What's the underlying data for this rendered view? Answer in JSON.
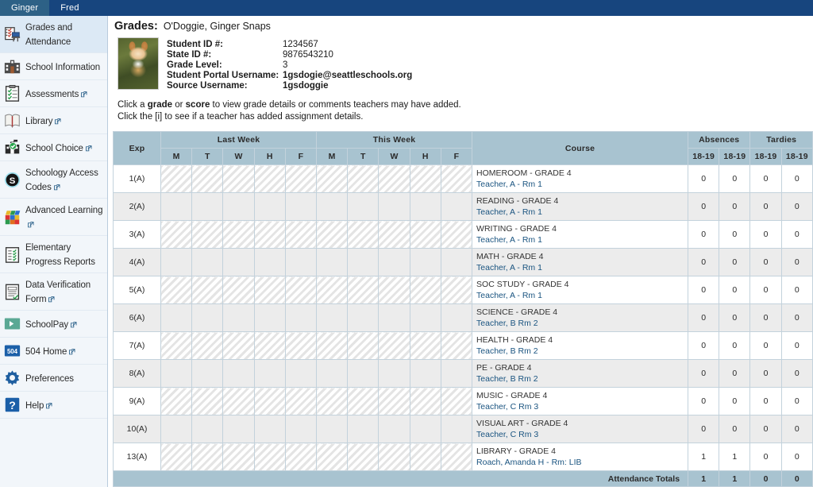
{
  "topbar": {
    "tabs": [
      {
        "label": "Ginger",
        "active": true
      },
      {
        "label": "Fred",
        "active": false
      }
    ]
  },
  "sidebar": {
    "items": [
      {
        "label": "Grades and Attendance",
        "icon": "grades-attendance-icon",
        "external": false,
        "selected": true
      },
      {
        "label": "School Information",
        "icon": "school-building-icon",
        "external": false,
        "selected": false
      },
      {
        "label": "Assessments",
        "icon": "clipboard-checklist-icon",
        "external": true,
        "selected": false
      },
      {
        "label": "Library",
        "icon": "open-book-icon",
        "external": true,
        "selected": false
      },
      {
        "label": "School Choice",
        "icon": "school-choice-icon",
        "external": true,
        "selected": false
      },
      {
        "label": "Schoology Access Codes",
        "icon": "schoology-s-icon",
        "external": true,
        "selected": false
      },
      {
        "label": "Advanced Learning",
        "icon": "rubiks-cube-icon",
        "external": true,
        "selected": false
      },
      {
        "label": "Elementary Progress Reports",
        "icon": "progress-report-icon",
        "external": false,
        "selected": false
      },
      {
        "label": "Data Verification Form",
        "icon": "document-check-icon",
        "external": true,
        "selected": false
      },
      {
        "label": "SchoolPay",
        "icon": "schoolpay-arrow-icon",
        "external": true,
        "selected": false
      },
      {
        "label": "504 Home",
        "icon": "504-badge-icon",
        "external": true,
        "selected": false
      },
      {
        "label": "Preferences",
        "icon": "gear-icon",
        "external": false,
        "selected": false
      },
      {
        "label": "Help",
        "icon": "question-mark-icon",
        "external": true,
        "selected": false
      }
    ]
  },
  "page": {
    "title": "Grades:",
    "student_name": "O'Doggie, Ginger Snaps"
  },
  "student": {
    "photo_alt": "student-photo",
    "fields": [
      {
        "label": "Student ID #:",
        "value": "1234567",
        "bold": false
      },
      {
        "label": "State ID #:",
        "value": "9876543210",
        "bold": false
      },
      {
        "label": "Grade Level:",
        "value": "3",
        "bold": false
      },
      {
        "label": "Student Portal Username:",
        "value": "1gsdogie@seattleschools.org",
        "bold": true
      },
      {
        "label": "Source Username:",
        "value": "1gsdoggie",
        "bold": true
      }
    ]
  },
  "instructions": {
    "line1_a": "Click a ",
    "line1_b": "grade",
    "line1_c": " or ",
    "line1_d": "score",
    "line1_e": " to view grade details or comments teachers may have added.",
    "line2": "Click the [i] to see if a teacher has added assignment details."
  },
  "table": {
    "headers": {
      "exp": "Exp",
      "last_week": "Last Week",
      "this_week": "This Week",
      "course": "Course",
      "absences": "Absences",
      "tardies": "Tardies",
      "days": [
        "M",
        "T",
        "W",
        "H",
        "F"
      ],
      "year_cols": [
        "18-19",
        "18-19",
        "18-19",
        "18-19"
      ]
    },
    "rows": [
      {
        "exp": "1(A)",
        "course": "HOMEROOM - GRADE 4",
        "teacher": "Teacher, A - Rm 1",
        "nums": [
          "0",
          "0",
          "0",
          "0"
        ]
      },
      {
        "exp": "2(A)",
        "course": "READING - GRADE 4",
        "teacher": "Teacher, A - Rm 1",
        "nums": [
          "0",
          "0",
          "0",
          "0"
        ]
      },
      {
        "exp": "3(A)",
        "course": "WRITING - GRADE 4",
        "teacher": "Teacher, A - Rm 1",
        "nums": [
          "0",
          "0",
          "0",
          "0"
        ]
      },
      {
        "exp": "4(A)",
        "course": "MATH - GRADE 4",
        "teacher": "Teacher, A - Rm 1",
        "nums": [
          "0",
          "0",
          "0",
          "0"
        ]
      },
      {
        "exp": "5(A)",
        "course": "SOC STUDY - GRADE 4",
        "teacher": "Teacher, A - Rm 1",
        "nums": [
          "0",
          "0",
          "0",
          "0"
        ]
      },
      {
        "exp": "6(A)",
        "course": "SCIENCE - GRADE 4",
        "teacher": "Teacher, B Rm 2",
        "nums": [
          "0",
          "0",
          "0",
          "0"
        ]
      },
      {
        "exp": "7(A)",
        "course": "HEALTH - GRADE 4",
        "teacher": "Teacher, B Rm 2",
        "nums": [
          "0",
          "0",
          "0",
          "0"
        ]
      },
      {
        "exp": "8(A)",
        "course": "PE - GRADE 4",
        "teacher": "Teacher, B Rm 2",
        "nums": [
          "0",
          "0",
          "0",
          "0"
        ]
      },
      {
        "exp": "9(A)",
        "course": "MUSIC - GRADE 4",
        "teacher": "Teacher, C Rm 3",
        "nums": [
          "0",
          "0",
          "0",
          "0"
        ]
      },
      {
        "exp": "10(A)",
        "course": "VISUAL ART - GRADE 4",
        "teacher": "Teacher, C Rm 3",
        "nums": [
          "0",
          "0",
          "0",
          "0"
        ]
      },
      {
        "exp": "13(A)",
        "course": "LIBRARY - GRADE 4",
        "teacher": "Roach, Amanda H - Rm: LIB",
        "nums": [
          "1",
          "1",
          "0",
          "0"
        ]
      }
    ],
    "totals": {
      "label": "Attendance Totals",
      "values": [
        "1",
        "1",
        "0",
        "0"
      ]
    }
  },
  "colors": {
    "topbar": "#17457e",
    "active_tab": "#2d6186",
    "sidebar_bg": "#f2f6fa",
    "sidebar_selected": "#dce9f5",
    "table_header": "#a8c3d0",
    "link": "#1a5480",
    "row_alt": "#ececec"
  }
}
